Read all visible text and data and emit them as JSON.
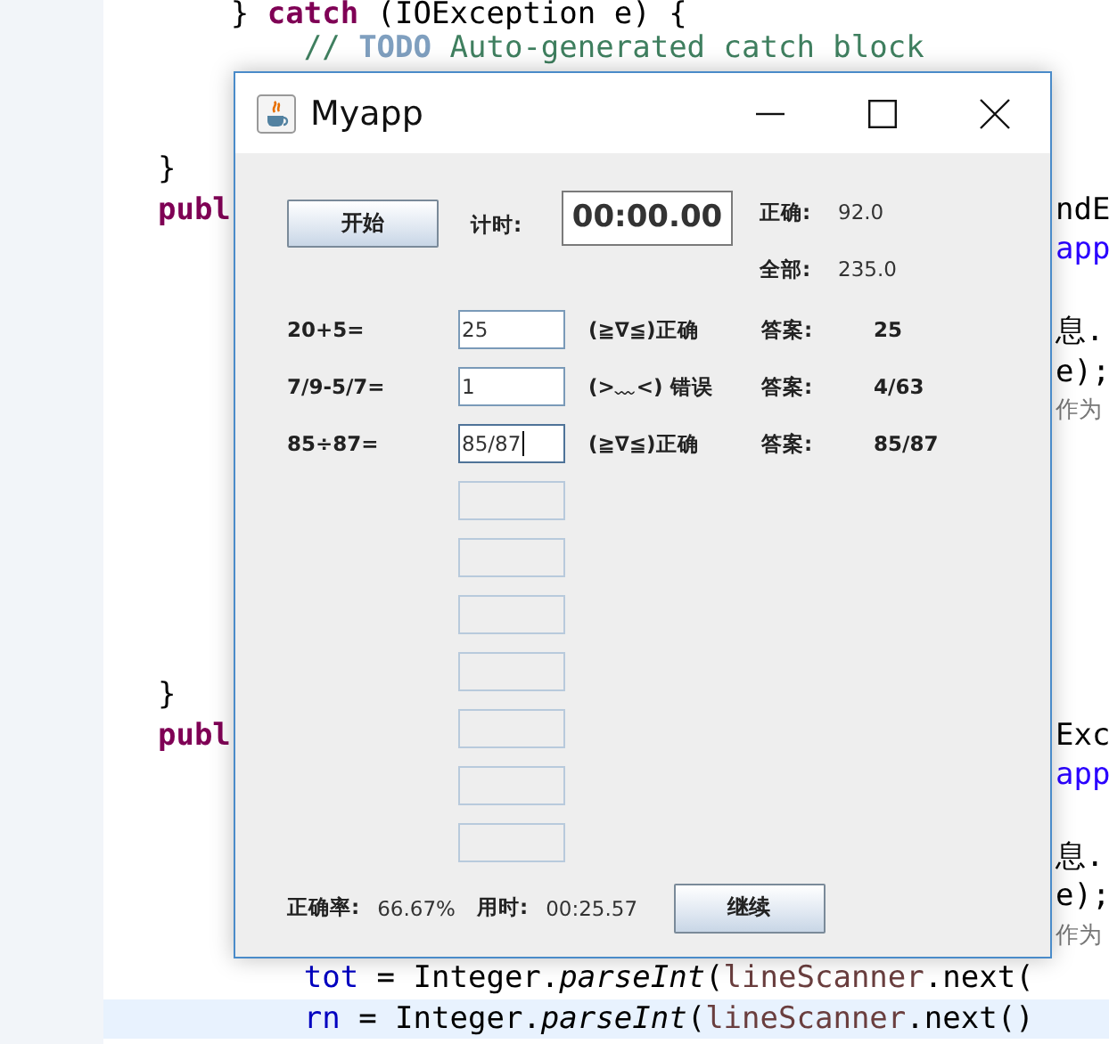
{
  "editor": {
    "lines": [
      {
        "current": false,
        "segments": [
          {
            "text": "      } ",
            "kind": "plain"
          },
          {
            "text": "catch",
            "kind": "keyword"
          },
          {
            "text": " (IOException e) {",
            "kind": "plain"
          }
        ]
      },
      {
        "current": false,
        "segments": [
          {
            "text": "          // ",
            "kind": "comment"
          },
          {
            "text": "TODO",
            "kind": "todo"
          },
          {
            "text": " Auto-generated catch block",
            "kind": "comment"
          }
        ]
      },
      {
        "current": false
      },
      {
        "current": false
      },
      {
        "current": false,
        "segments": [
          {
            "text": "  }",
            "kind": "plain"
          }
        ]
      },
      {
        "current": false,
        "segments": [
          {
            "text": "  publ",
            "kind": "keyword"
          }
        ],
        "fragment": {
          "text": "ndE",
          "kind": "plain"
        }
      },
      {
        "current": false,
        "fragment": {
          "text": "app",
          "kind": "string"
        }
      },
      {
        "current": false
      },
      {
        "current": false,
        "fragment": {
          "text": "息.",
          "kind": "plain"
        }
      },
      {
        "current": false,
        "fragment": {
          "text": "e);",
          "kind": "plain"
        }
      },
      {
        "current": false,
        "fragment": {
          "text": "作为",
          "kind": "note"
        }
      },
      {
        "current": false
      },
      {
        "current": false
      },
      {
        "current": false
      },
      {
        "current": false
      },
      {
        "current": false
      },
      {
        "current": false
      },
      {
        "current": false,
        "segments": [
          {
            "text": "  }",
            "kind": "plain"
          }
        ]
      },
      {
        "current": false,
        "segments": [
          {
            "text": "  publ",
            "kind": "keyword"
          }
        ],
        "fragment": {
          "text": "Exc",
          "kind": "plain"
        }
      },
      {
        "current": false,
        "fragment": {
          "text": "app",
          "kind": "string"
        }
      },
      {
        "current": false
      },
      {
        "current": false,
        "fragment": {
          "text": "息.",
          "kind": "plain"
        }
      },
      {
        "current": false,
        "fragment": {
          "text": "e);",
          "kind": "plain"
        }
      },
      {
        "current": false,
        "fragment": {
          "text": "作为",
          "kind": "note"
        }
      },
      {
        "current": false,
        "segments": [
          {
            "text": "          tot",
            "kind": "field"
          },
          {
            "text": " = Integer.",
            "kind": "plain"
          },
          {
            "text": "parseInt",
            "kind": "method"
          },
          {
            "text": "(",
            "kind": "plain"
          },
          {
            "text": "lineScanner",
            "kind": "variable"
          },
          {
            "text": ".next(",
            "kind": "plain"
          }
        ]
      },
      {
        "current": true,
        "segments": [
          {
            "text": "          rn",
            "kind": "field"
          },
          {
            "text": " = Integer.",
            "kind": "plain"
          },
          {
            "text": "parseInt",
            "kind": "method"
          },
          {
            "text": "(",
            "kind": "plain"
          },
          {
            "text": "lineScanner",
            "kind": "variable"
          },
          {
            "text": ".next()",
            "kind": "plain"
          }
        ]
      }
    ]
  },
  "window": {
    "title": "Myapp"
  },
  "start_button": "开始",
  "timer": {
    "label": "计时:",
    "value": "00:00.00"
  },
  "stats": [
    {
      "label": "正确:",
      "value": "92.0"
    },
    {
      "label": "全部:",
      "value": "235.0"
    }
  ],
  "questions": [
    {
      "question": "20+5=",
      "answer_input": "25",
      "focused": false,
      "result": "(≧∇≦)正确",
      "answer_label": "答案:",
      "answer": "25"
    },
    {
      "question": "7/9-5/7=",
      "answer_input": "1",
      "focused": false,
      "result": "(>﹏<) 错误",
      "answer_label": "答案:",
      "answer": "4/63"
    },
    {
      "question": "85÷87=",
      "answer_input": "85/87",
      "focused": true,
      "result": "(≧∇≦)正确",
      "answer_label": "答案:",
      "answer": "85/87"
    }
  ],
  "blank_fields": [
    {
      "disabled": true
    },
    {
      "disabled": true
    },
    {
      "disabled": true
    },
    {
      "disabled": true
    },
    {
      "disabled": true
    },
    {
      "disabled": true
    },
    {
      "disabled": true
    }
  ],
  "footer": {
    "rate_label": "正确率:",
    "rate": "66.67%",
    "time_label": "用时:",
    "time": "00:25.57",
    "continue_button": "继续"
  }
}
